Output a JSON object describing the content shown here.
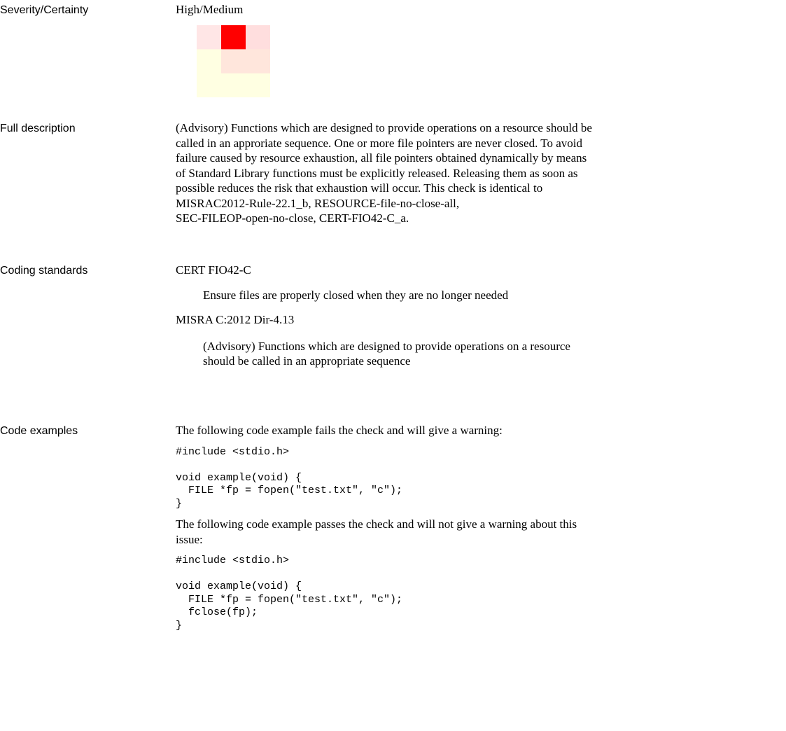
{
  "severity_row": {
    "label": "Severity/Certainty",
    "value": "High/Medium"
  },
  "severity_matrix": {
    "colors": [
      [
        "#ffe6e6",
        "#ff0000",
        "#ffdede"
      ],
      [
        "#ffffe2",
        "#ffe6dc",
        "#ffe6dc"
      ],
      [
        "#ffffe2",
        "#ffffe2",
        "#ffffe2"
      ]
    ]
  },
  "description_row": {
    "label": "Full description",
    "lines": [
      " (Advisory) Functions which are designed to provide operations on a resource should be",
      "called in an approriate sequence.  One or more file pointers are never closed. To avoid",
      "failure caused by resource exhaustion, all file pointers obtained dynamically by means",
      "of Standard Library functions must be explicitly released.  Releasing them as soon as",
      "possible reduces the risk that exhaustion will occur. This check is identical to",
      "MISRAC2012-Rule-22.1_b, RESOURCE-file-no-close-all,",
      "SEC-FILEOP-open-no-close, CERT-FIO42-C_a."
    ]
  },
  "standards_row": {
    "label": "Coding standards",
    "items": [
      {
        "title": "CERT FIO42-C",
        "description": [
          "Ensure files are properly closed when they are no longer needed"
        ]
      },
      {
        "title": "MISRA C:2012 Dir-4.13",
        "description": [
          "(Advisory) Functions which are designed to provide operations on a resource",
          "should be called in an appropriate sequence"
        ]
      }
    ]
  },
  "examples_row": {
    "label": "Code examples",
    "fail_intro": "The following code example fails the check and will give a warning:",
    "fail_code": "#include <stdio.h>\n\nvoid example(void) {\n  FILE *fp = fopen(\"test.txt\", \"c\");\n}",
    "pass_intro_lines": [
      "The following code example passes the check and will not give a warning about this",
      "issue:"
    ],
    "pass_code": "#include <stdio.h>\n\nvoid example(void) {\n  FILE *fp = fopen(\"test.txt\", \"c\");\n  fclose(fp);\n}"
  }
}
